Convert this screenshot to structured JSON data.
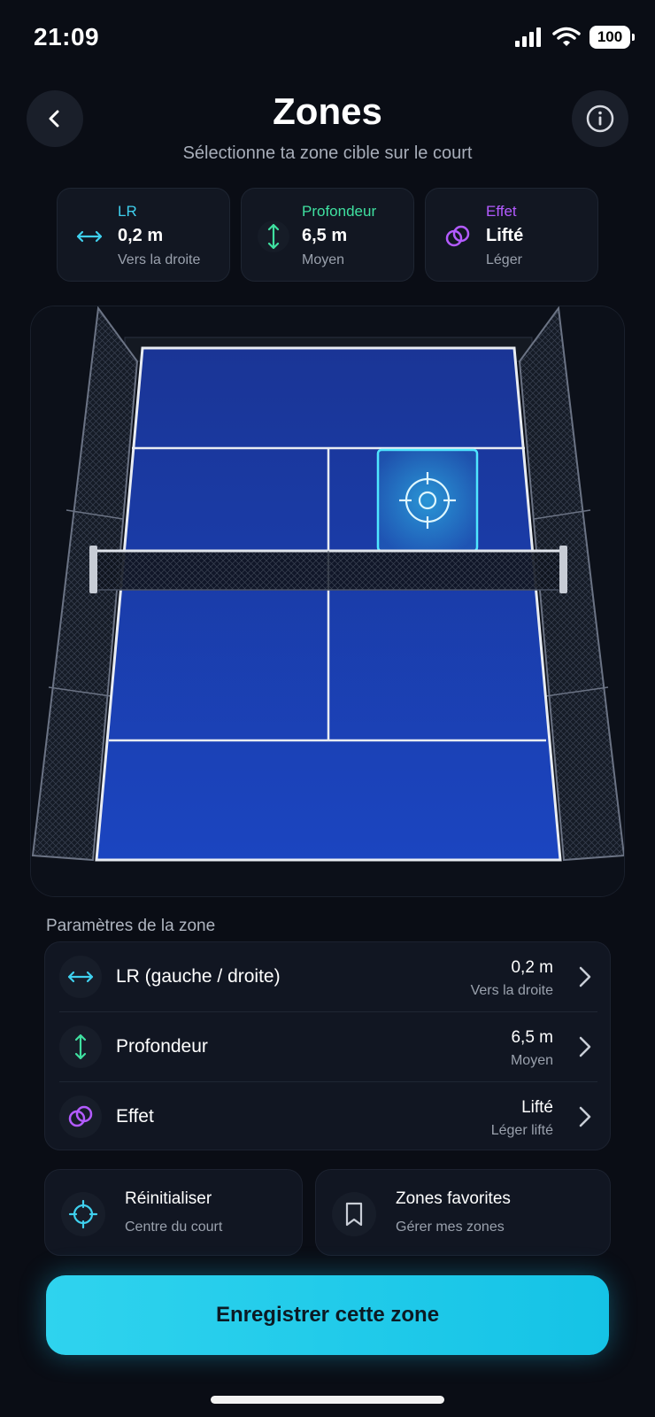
{
  "status": {
    "time": "21:09",
    "battery": "100"
  },
  "header": {
    "title": "Zones",
    "subtitle": "Sélectionne ta zone cible sur le court"
  },
  "summary": [
    {
      "label": "LR",
      "value": "0,2 m",
      "desc": "Vers la droite",
      "color": "#3fd0ee",
      "icon": "horizontal-arrows-icon"
    },
    {
      "label": "Profondeur",
      "value": "6,5 m",
      "desc": "Moyen",
      "color": "#3fe0a0",
      "icon": "vertical-arrows-icon"
    },
    {
      "label": "Effet",
      "value": "Lifté",
      "desc": "Léger",
      "color": "#b35bff",
      "icon": "spin-icon"
    }
  ],
  "params": {
    "title": "Paramètres de la zone",
    "rows": [
      {
        "label": "LR (gauche / droite)",
        "value": "0,2 m",
        "desc": "Vers la droite",
        "color": "#3fd0ee",
        "icon": "horizontal-arrows-icon"
      },
      {
        "label": "Profondeur",
        "value": "6,5 m",
        "desc": "Moyen",
        "color": "#3fe0a0",
        "icon": "vertical-arrows-icon"
      },
      {
        "label": "Effet",
        "value": "Lifté",
        "desc": "Léger lifté",
        "color": "#b35bff",
        "icon": "spin-icon"
      }
    ]
  },
  "actions": {
    "reset": {
      "label": "Réinitialiser",
      "desc": "Centre du court",
      "icon": "crosshair-icon"
    },
    "favorites": {
      "label": "Zones favorites",
      "desc": "Gérer mes zones",
      "icon": "bookmark-icon"
    }
  },
  "cta": {
    "label": "Enregistrer cette zone"
  },
  "colors": {
    "accent": "#25cdec",
    "court": "#1a3fae",
    "background": "#0a0d15"
  }
}
